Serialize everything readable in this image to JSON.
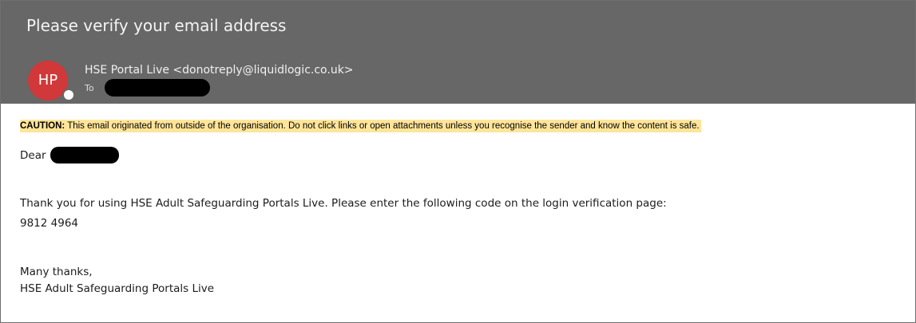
{
  "email": {
    "subject": "Please verify your email address",
    "sender": {
      "avatar_initials": "HP",
      "avatar_color": "#d03839",
      "display": "HSE Portal Live <donotreply@liquidlogic.co.uk>",
      "to_label": "To"
    },
    "caution": {
      "label": "CAUTION:",
      "text": " This email originated from outside of the organisation. Do not click links or open attachments unless you recognise the sender and know the content is safe.",
      "highlight_color": "#ffe59a"
    },
    "body": {
      "greeting": "Dear",
      "intro": "Thank you for using HSE Adult Safeguarding Portals Live. Please enter the following code on the login verification page:",
      "code": "9812 4964",
      "closing": "Many thanks,",
      "signature": "HSE Adult Safeguarding Portals Live"
    }
  },
  "colors": {
    "header_background": "#676767"
  }
}
